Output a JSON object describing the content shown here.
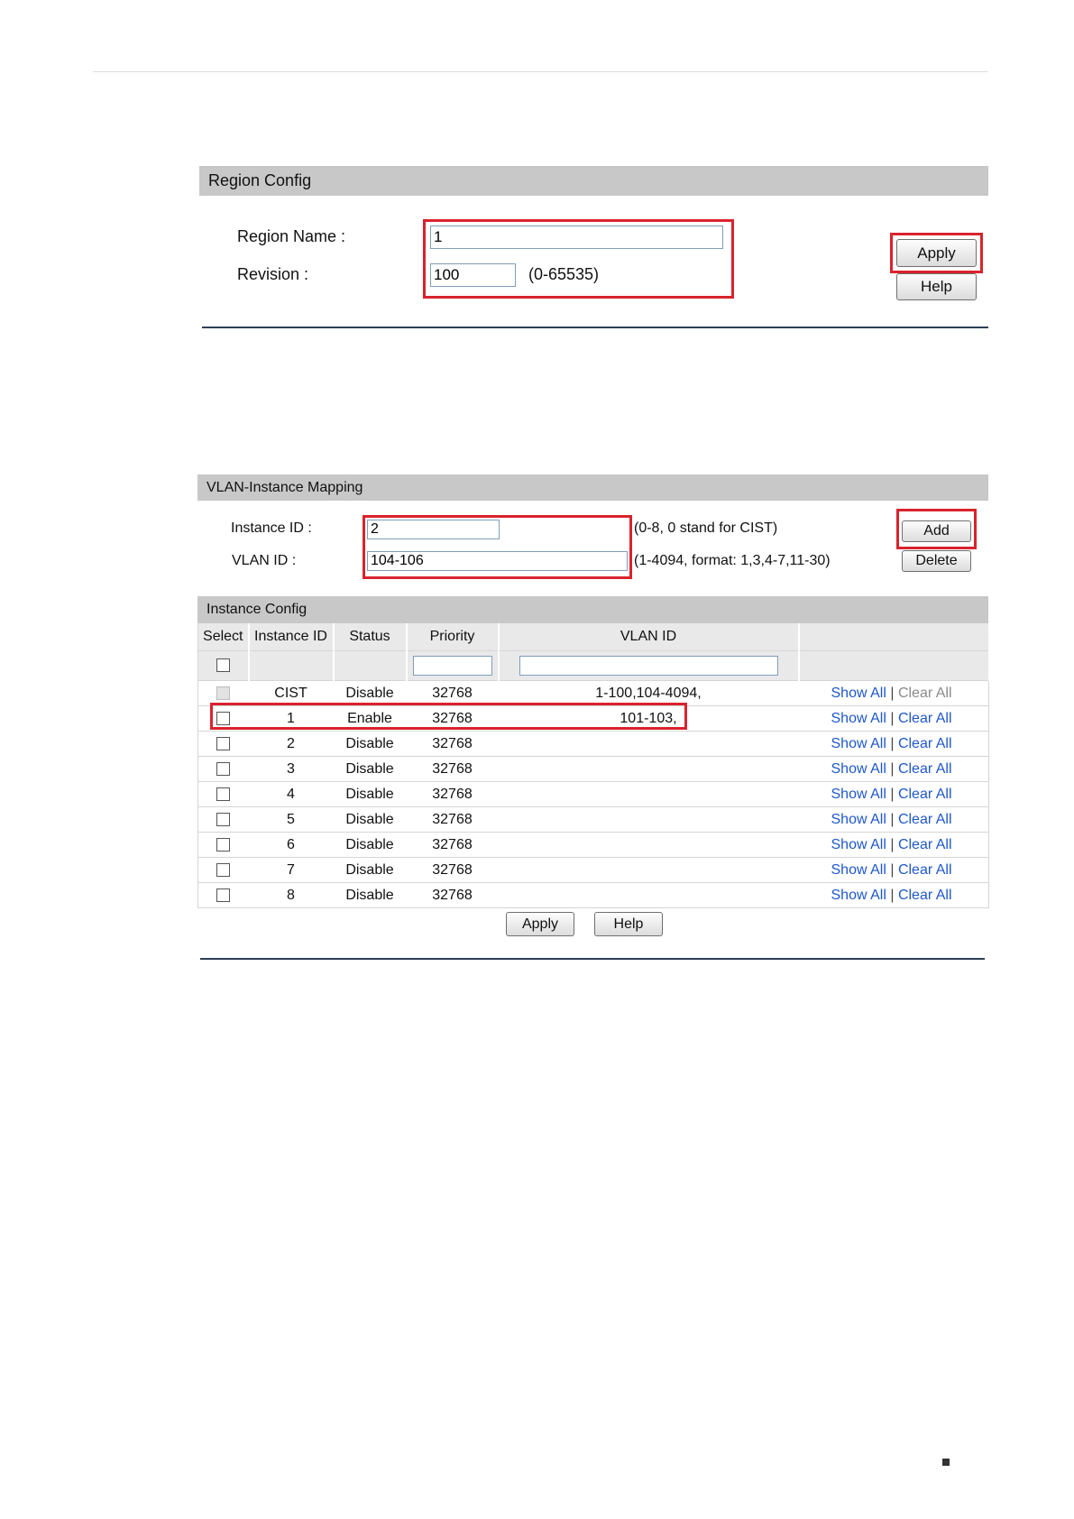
{
  "region": {
    "header": "Region Config",
    "name_label": "Region Name :",
    "name_value": "1",
    "revision_label": "Revision :",
    "revision_value": "100",
    "revision_hint": "(0-65535)",
    "apply_label": "Apply",
    "help_label": "Help"
  },
  "mapping": {
    "header": "VLAN-Instance Mapping",
    "instance_label": "Instance ID :",
    "instance_value": "2",
    "instance_hint": "(0-8, 0 stand for CIST)",
    "vlan_label": "VLAN ID :",
    "vlan_value": "104-106",
    "vlan_hint": "(1-4094, format: 1,3,4-7,11-30)",
    "add_label": "Add",
    "delete_label": "Delete"
  },
  "instance_config": {
    "header": "Instance Config",
    "columns": [
      "Select",
      "Instance ID",
      "Status",
      "Priority",
      "VLAN ID",
      ""
    ],
    "show_all_label": "Show All",
    "clear_all_label": "Clear All",
    "separator": "|",
    "rows": [
      {
        "id": "CIST",
        "status": "Disable",
        "priority": "32768",
        "vlan": "1-100,104-4094,",
        "checkbox_disabled": true,
        "clear_disabled": true
      },
      {
        "id": "1",
        "status": "Enable",
        "priority": "32768",
        "vlan": "101-103,"
      },
      {
        "id": "2",
        "status": "Disable",
        "priority": "32768",
        "vlan": ""
      },
      {
        "id": "3",
        "status": "Disable",
        "priority": "32768",
        "vlan": ""
      },
      {
        "id": "4",
        "status": "Disable",
        "priority": "32768",
        "vlan": ""
      },
      {
        "id": "5",
        "status": "Disable",
        "priority": "32768",
        "vlan": ""
      },
      {
        "id": "6",
        "status": "Disable",
        "priority": "32768",
        "vlan": ""
      },
      {
        "id": "7",
        "status": "Disable",
        "priority": "32768",
        "vlan": ""
      },
      {
        "id": "8",
        "status": "Disable",
        "priority": "32768",
        "vlan": ""
      }
    ],
    "apply_label": "Apply",
    "help_label": "Help"
  },
  "colors": {
    "highlight": "#d9232d",
    "link": "#1f58c9",
    "header_bg": "#c8c8c8",
    "rule": "#2c3e55"
  }
}
